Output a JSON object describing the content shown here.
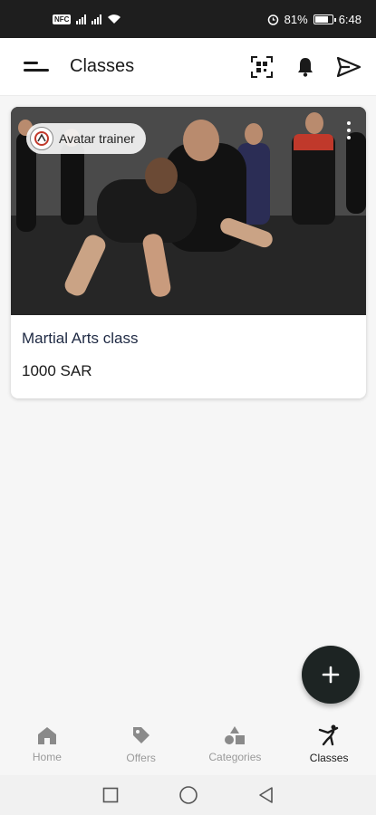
{
  "status_bar": {
    "net_chip": "NFC",
    "battery": "81%",
    "battery_level": 0.81,
    "time": "6:48"
  },
  "app_bar": {
    "title": "Classes",
    "icons": [
      "menu-icon",
      "qr-scan-icon",
      "bell-icon",
      "send-icon"
    ]
  },
  "classes": [
    {
      "trainer": "Avatar trainer",
      "title": "Martial Arts class",
      "price": "1000 SAR"
    }
  ],
  "fab": {
    "icon": "plus-icon"
  },
  "bottom_nav": {
    "items": [
      {
        "label": "Home",
        "icon": "home-icon"
      },
      {
        "label": "Offers",
        "icon": "tag-icon"
      },
      {
        "label": "Categories",
        "icon": "shapes-icon"
      },
      {
        "label": "Classes",
        "icon": "martial-arts-icon"
      }
    ],
    "active": "Classes"
  },
  "colors": {
    "status_bar_bg": "#1e1e1e",
    "fab_bg": "#1d2423",
    "nav_inactive": "#9a9a9a",
    "nav_active": "#1a1a1a",
    "card_title": "#1f2a44"
  }
}
